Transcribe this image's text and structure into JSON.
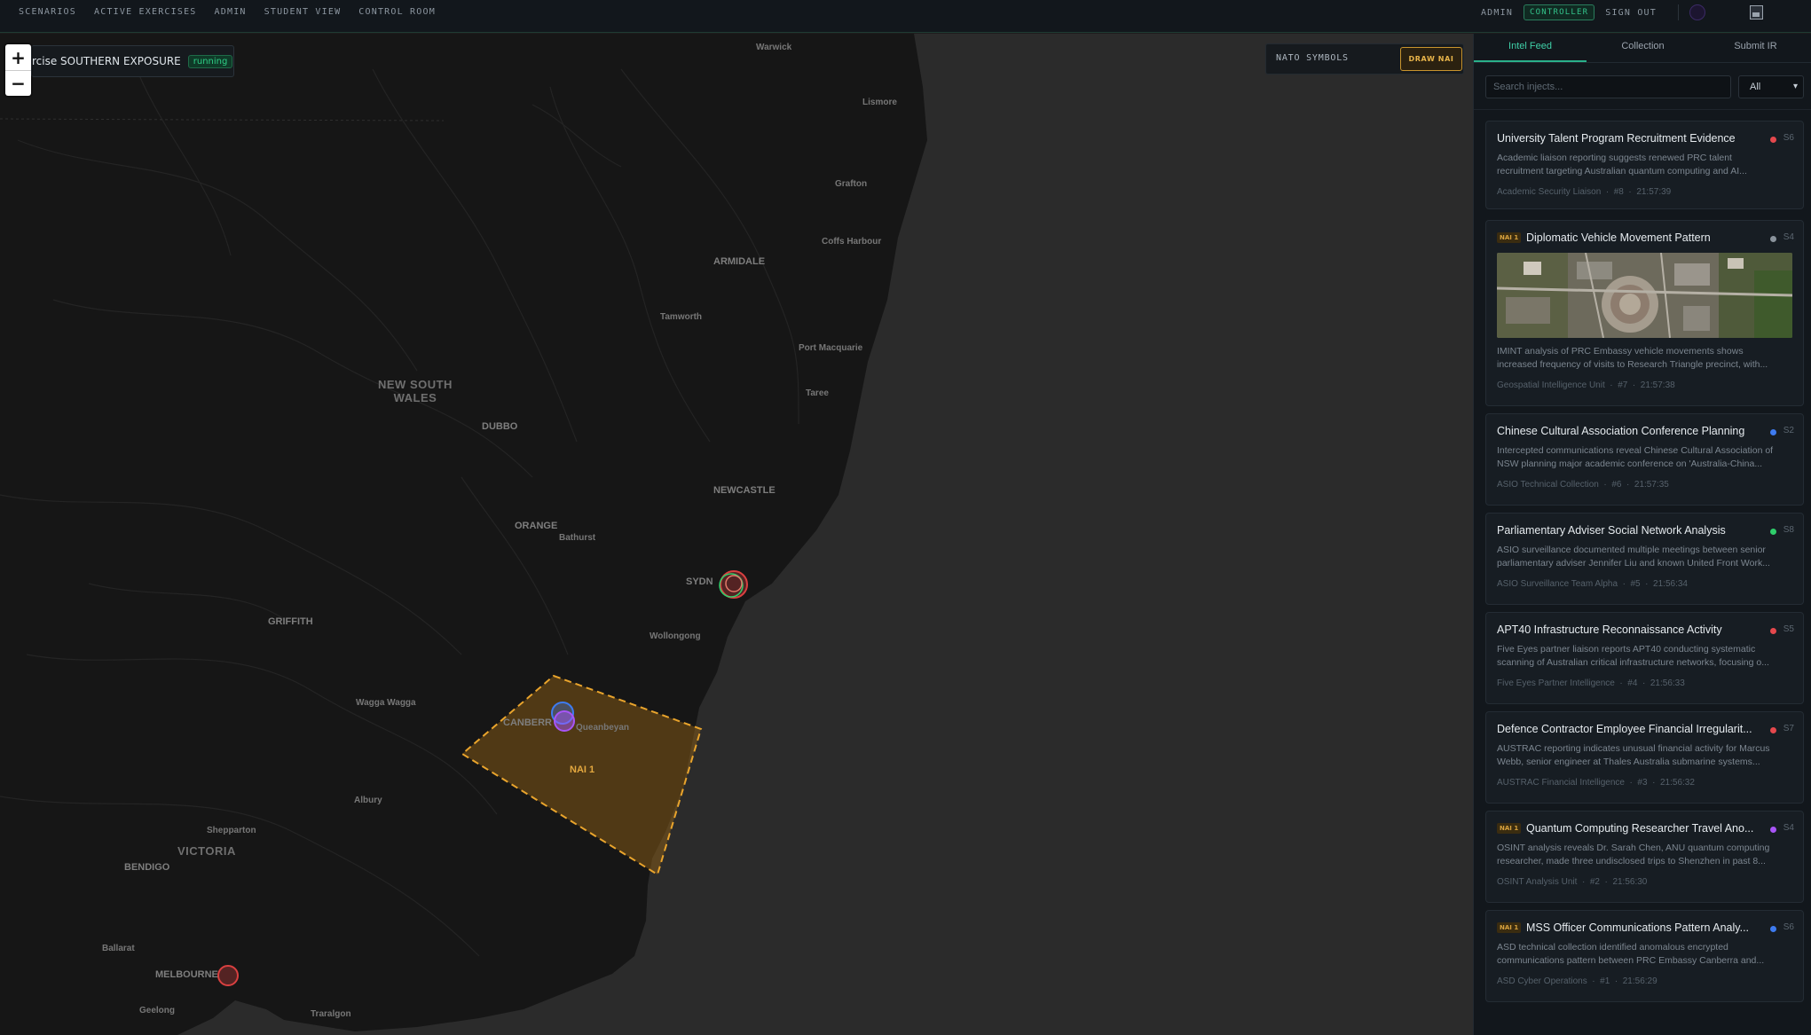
{
  "nav": {
    "items": [
      "SCENARIOS",
      "ACTIVE EXERCISES",
      "ADMIN",
      "STUDENT VIEW",
      "CONTROL ROOM"
    ],
    "user_role": "ADMIN",
    "mode": "CONTROLLER",
    "sign_out": "SIGN OUT"
  },
  "map": {
    "zoom_in": "+",
    "zoom_out": "−",
    "exercise_name": "rcise SOUTHERN EXPOSURE",
    "exercise_status": "running",
    "nato_label": "NATO SYMBOLS",
    "draw_button": "DRAW NAI",
    "nai_name": "NAI 1",
    "labels": {
      "warwick": "Warwick",
      "lismore": "Lismore",
      "grafton": "Grafton",
      "coffs": "Coffs Harbour",
      "armidale": "ARMIDALE",
      "tamworth": "Tamworth",
      "port_macquarie": "Port Macquarie",
      "taree": "Taree",
      "nsw": "NEW SOUTH\nWALES",
      "dubbo": "DUBBO",
      "newcastle": "NEWCASTLE",
      "orange": "ORANGE",
      "bathurst": "Bathurst",
      "sydney": "SYDN",
      "griffith": "GRIFFITH",
      "wollongong": "Wollongong",
      "wagga": "Wagga Wagga",
      "canberra": "CANBERR",
      "queanbeyan": "Queanbeyan",
      "albury": "Albury",
      "shepparton": "Shepparton",
      "victoria": "VICTORIA",
      "bendigo": "BENDIGO",
      "ballarat": "Ballarat",
      "melbourne": "MELBOURNE",
      "geelong": "Geelong",
      "traralgon": "Traralgon"
    }
  },
  "panel": {
    "tabs": [
      "Intel Feed",
      "Collection",
      "Submit IR"
    ],
    "active_tab": "Intel Feed",
    "search_placeholder": "Search injects...",
    "filter_value": "All",
    "colors": {
      "red": "#e5484d",
      "gray": "#8a939c",
      "blue": "#3e7bf0",
      "green": "#2fcf6b",
      "purple": "#a855f7"
    },
    "injects": [
      {
        "title": "University Talent Program Recruitment Evidence",
        "nai": "",
        "severity": "S6",
        "dot": "#e5484d",
        "desc_1": "Academic liaison reporting suggests renewed PRC talent",
        "desc_2": "recruitment targeting Australian quantum computing and AI...",
        "source": "Academic Security Liaison",
        "num": "#8",
        "time": "21:57:39"
      },
      {
        "title": "Diplomatic Vehicle Movement Pattern",
        "nai": "NAI 1",
        "severity": "S4",
        "dot": "#8a939c",
        "desc_1": "IMINT analysis of PRC Embassy vehicle movements shows",
        "desc_2": "increased frequency of visits to Research Triangle precinct, with...",
        "source": "Geospatial Intelligence Unit",
        "num": "#7",
        "time": "21:57:38"
      },
      {
        "title": "Chinese Cultural Association Conference Planning",
        "nai": "",
        "severity": "S2",
        "dot": "#3e7bf0",
        "desc_1": "Intercepted communications reveal Chinese Cultural Association of",
        "desc_2": "NSW planning major academic conference on 'Australia-China...",
        "source": "ASIO Technical Collection",
        "num": "#6",
        "time": "21:57:35"
      },
      {
        "title": "Parliamentary Adviser Social Network Analysis",
        "nai": "",
        "severity": "S8",
        "dot": "#2fcf6b",
        "desc_1": "ASIO surveillance documented multiple meetings between senior",
        "desc_2": "parliamentary adviser Jennifer Liu and known United Front Work...",
        "source": "ASIO Surveillance Team Alpha",
        "num": "#5",
        "time": "21:56:34"
      },
      {
        "title": "APT40 Infrastructure Reconnaissance Activity",
        "nai": "",
        "severity": "S5",
        "dot": "#e5484d",
        "desc_1": "Five Eyes partner liaison reports APT40 conducting systematic",
        "desc_2": "scanning of Australian critical infrastructure networks, focusing o...",
        "source": "Five Eyes Partner Intelligence",
        "num": "#4",
        "time": "21:56:33"
      },
      {
        "title": "Defence Contractor Employee Financial Irregularit...",
        "nai": "",
        "severity": "S7",
        "dot": "#e5484d",
        "desc_1": "AUSTRAC reporting indicates unusual financial activity for Marcus",
        "desc_2": "Webb, senior engineer at Thales Australia submarine systems...",
        "source": "AUSTRAC Financial Intelligence",
        "num": "#3",
        "time": "21:56:32"
      },
      {
        "title": "Quantum Computing Researcher Travel Ano...",
        "nai": "NAI 1",
        "severity": "S4",
        "dot": "#a855f7",
        "desc_1": "OSINT analysis reveals Dr. Sarah Chen, ANU quantum computing",
        "desc_2": "researcher, made three undisclosed trips to Shenzhen in past 8...",
        "source": "OSINT Analysis Unit",
        "num": "#2",
        "time": "21:56:30"
      },
      {
        "title": "MSS Officer Communications Pattern Analy...",
        "nai": "NAI 1",
        "severity": "S6",
        "dot": "#3e7bf0",
        "desc_1": "ASD technical collection identified anomalous encrypted",
        "desc_2": "communications pattern between PRC Embassy Canberra and...",
        "source": "ASD Cyber Operations",
        "num": "#1",
        "time": "21:56:29"
      }
    ]
  }
}
